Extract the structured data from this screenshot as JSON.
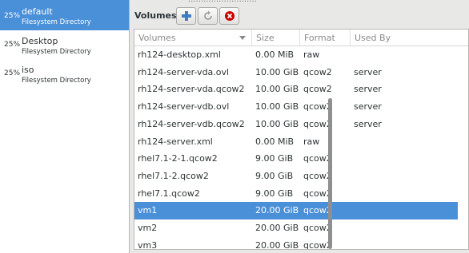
{
  "pools": [
    {
      "usage": "25%",
      "name": "default",
      "type": "Filesystem Directory",
      "selected": true
    },
    {
      "usage": "25%",
      "name": "Desktop",
      "type": "Filesystem Directory",
      "selected": false
    },
    {
      "usage": "25%",
      "name": "iso",
      "type": "Filesystem Directory",
      "selected": false
    }
  ],
  "top_fragment": "...........................",
  "volumes_section": {
    "label": "Volumes",
    "add_icon": "plus-icon",
    "refresh_icon": "refresh-icon",
    "delete_icon": "delete-icon"
  },
  "table": {
    "columns": [
      "Volumes",
      "Size",
      "Format",
      "Used By"
    ],
    "sort_icon": "chevron-down-icon",
    "rows": [
      {
        "name": "rh124-desktop.xml",
        "size": "0.00 MiB",
        "format": "raw",
        "used_by": "",
        "selected": false
      },
      {
        "name": "rh124-server-vda.ovl",
        "size": "10.00 GiB",
        "format": "qcow2",
        "used_by": "server",
        "selected": false
      },
      {
        "name": "rh124-server-vda.qcow2",
        "size": "10.00 GiB",
        "format": "qcow2",
        "used_by": "server",
        "selected": false
      },
      {
        "name": "rh124-server-vdb.ovl",
        "size": "10.00 GiB",
        "format": "qcow2",
        "used_by": "server",
        "selected": false
      },
      {
        "name": "rh124-server-vdb.qcow2",
        "size": "10.00 GiB",
        "format": "qcow2",
        "used_by": "server",
        "selected": false
      },
      {
        "name": "rh124-server.xml",
        "size": "0.00 MiB",
        "format": "raw",
        "used_by": "",
        "selected": false
      },
      {
        "name": "rhel7.1-2-1.qcow2",
        "size": "9.00 GiB",
        "format": "qcow2",
        "used_by": "",
        "selected": false
      },
      {
        "name": "rhel7.1-2.qcow2",
        "size": "9.00 GiB",
        "format": "qcow2",
        "used_by": "",
        "selected": false
      },
      {
        "name": "rhel7.1.qcow2",
        "size": "9.00 GiB",
        "format": "qcow2",
        "used_by": "",
        "selected": false
      },
      {
        "name": "vm1",
        "size": "20.00 GiB",
        "format": "qcow2",
        "used_by": "",
        "selected": true
      },
      {
        "name": "vm2",
        "size": "20.00 GiB",
        "format": "qcow2",
        "used_by": "",
        "selected": false
      },
      {
        "name": "vm3",
        "size": "20.00 GiB",
        "format": "qcow2",
        "used_by": "",
        "selected": false
      }
    ]
  },
  "colors": {
    "selection": "#4a90d9",
    "add_icon": "#3d7dc4",
    "delete_icon": "#cc0000"
  }
}
